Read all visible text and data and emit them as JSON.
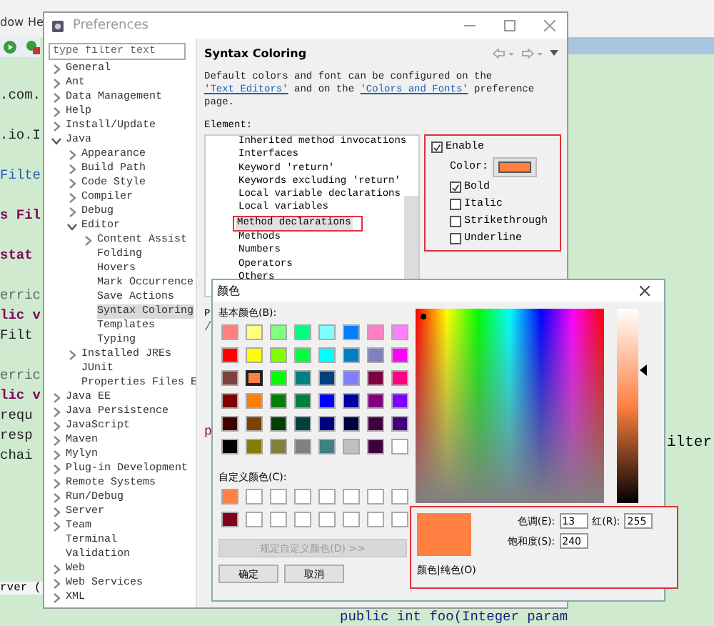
{
  "background_editor": {
    "menu": [
      "dow",
      "He"
    ],
    "left_code": [
      [
        {
          "text": ".com.",
          "kind": "plain"
        }
      ],
      [
        {
          "text": ".io.I",
          "kind": "plain"
        }
      ],
      [
        {
          "text": "Filte",
          "kind": "type"
        }
      ],
      [
        {
          "text": "s Fil",
          "kind": "keyword"
        }
      ],
      [
        {
          "text": "stat",
          "kind": "keyword"
        }
      ],
      [
        {
          "text": "erric",
          "kind": "annotation"
        },
        {
          "text": "lic v",
          "kind": "keyword"
        },
        {
          "text": "Filt",
          "kind": "plain"
        }
      ],
      [
        {
          "text": "erric",
          "kind": "annotation"
        },
        {
          "text": "lic v",
          "kind": "keyword"
        },
        {
          "text": "requ",
          "kind": "plain"
        },
        {
          "text": "resp",
          "kind": "plain"
        },
        {
          "text": "chai",
          "kind": "plain"
        }
      ]
    ],
    "bottom_left": "rver (",
    "right_code": "ilter",
    "bottom_code": "public int foo(Integer param"
  },
  "preferences": {
    "title": "Preferences",
    "filter": {
      "placeholder": "type filter text"
    },
    "tree": [
      {
        "label": "General",
        "kind": "group",
        "expanded": false,
        "selected": false
      },
      {
        "label": "Ant",
        "kind": "group",
        "expanded": false,
        "selected": false
      },
      {
        "label": "Data Management",
        "kind": "group",
        "expanded": false,
        "selected": false
      },
      {
        "label": "Help",
        "kind": "group",
        "expanded": false,
        "selected": false
      },
      {
        "label": "Install/Update",
        "kind": "group",
        "expanded": false,
        "selected": false
      },
      {
        "label": "Java",
        "kind": "group",
        "expanded": true,
        "selected": false,
        "children": [
          {
            "label": "Appearance",
            "kind": "group",
            "expanded": false,
            "selected": false
          },
          {
            "label": "Build Path",
            "kind": "group",
            "expanded": false,
            "selected": false
          },
          {
            "label": "Code Style",
            "kind": "group",
            "expanded": false,
            "selected": false
          },
          {
            "label": "Compiler",
            "kind": "group",
            "expanded": false,
            "selected": false
          },
          {
            "label": "Debug",
            "kind": "group",
            "expanded": false,
            "selected": false
          },
          {
            "label": "Editor",
            "kind": "group",
            "expanded": true,
            "selected": false,
            "children": [
              {
                "label": "Content Assist",
                "kind": "group",
                "expanded": false,
                "selected": false
              },
              {
                "label": "Folding",
                "kind": "leaf",
                "selected": false
              },
              {
                "label": "Hovers",
                "kind": "leaf",
                "selected": false
              },
              {
                "label": "Mark Occurrence",
                "kind": "leaf",
                "selected": false
              },
              {
                "label": "Save Actions",
                "kind": "leaf",
                "selected": false
              },
              {
                "label": "Syntax Coloring",
                "kind": "leaf",
                "selected": true
              },
              {
                "label": "Templates",
                "kind": "leaf",
                "selected": false
              },
              {
                "label": "Typing",
                "kind": "leaf",
                "selected": false
              }
            ]
          },
          {
            "label": "Installed JREs",
            "kind": "group",
            "expanded": false,
            "selected": false
          },
          {
            "label": "JUnit",
            "kind": "leaf",
            "selected": false
          },
          {
            "label": "Properties Files E",
            "kind": "leaf",
            "selected": false
          }
        ]
      },
      {
        "label": "Java EE",
        "kind": "group",
        "expanded": false,
        "selected": false
      },
      {
        "label": "Java Persistence",
        "kind": "group",
        "expanded": false,
        "selected": false
      },
      {
        "label": "JavaScript",
        "kind": "group",
        "expanded": false,
        "selected": false
      },
      {
        "label": "Maven",
        "kind": "group",
        "expanded": false,
        "selected": false
      },
      {
        "label": "Mylyn",
        "kind": "group",
        "expanded": false,
        "selected": false
      },
      {
        "label": "Plug-in Development",
        "kind": "group",
        "expanded": false,
        "selected": false
      },
      {
        "label": "Remote Systems",
        "kind": "group",
        "expanded": false,
        "selected": false
      },
      {
        "label": "Run/Debug",
        "kind": "group",
        "expanded": false,
        "selected": false
      },
      {
        "label": "Server",
        "kind": "group",
        "expanded": false,
        "selected": false
      },
      {
        "label": "Team",
        "kind": "group",
        "expanded": false,
        "selected": false
      },
      {
        "label": "Terminal",
        "kind": "leaf",
        "selected": false
      },
      {
        "label": "Validation",
        "kind": "leaf",
        "selected": false
      },
      {
        "label": "Web",
        "kind": "group",
        "expanded": false,
        "selected": false
      },
      {
        "label": "Web Services",
        "kind": "group",
        "expanded": false,
        "selected": false
      },
      {
        "label": "XML",
        "kind": "group",
        "expanded": false,
        "selected": false
      }
    ],
    "page_title": "Syntax Coloring",
    "description": "Default colors and font can be configured on the ",
    "link_1": "'Text Editors'",
    "description_2": " and on the ",
    "link_2": "'Colors and Fonts'",
    "description_3": " preference page.",
    "element_label": "Element:",
    "elements": [
      {
        "label": "Inherited method invocations",
        "selected": false
      },
      {
        "label": "Interfaces",
        "selected": false
      },
      {
        "label": "Keyword 'return'",
        "selected": false
      },
      {
        "label": "Keywords excluding 'return'",
        "selected": false
      },
      {
        "label": "Local variable declarations",
        "selected": false
      },
      {
        "label": "Local variables",
        "selected": false
      },
      {
        "label": "Method declarations",
        "selected": true
      },
      {
        "label": "Methods",
        "selected": false
      },
      {
        "label": "Numbers",
        "selected": false
      },
      {
        "label": "Operators",
        "selected": false
      },
      {
        "label": "Others",
        "selected": false
      }
    ],
    "options": {
      "enable": {
        "label": "Enable",
        "checked": true
      },
      "color_label": "Color:",
      "color": "#ff8040",
      "styles": [
        {
          "label": "Bold",
          "checked": true
        },
        {
          "label": "Italic",
          "checked": false
        },
        {
          "label": "Strikethrough",
          "checked": false
        },
        {
          "label": "Underline",
          "checked": false
        }
      ]
    },
    "preview_label": "P",
    "preview_code": [
      "/",
      "p"
    ]
  },
  "color_dialog": {
    "title": "颜色",
    "basic_label": "基本颜色(B):",
    "basic_colors": [
      {
        "color": "#ff8080",
        "selected": false
      },
      {
        "color": "#ffff80",
        "selected": false
      },
      {
        "color": "#80ff80",
        "selected": false
      },
      {
        "color": "#00ff80",
        "selected": false
      },
      {
        "color": "#80ffff",
        "selected": false
      },
      {
        "color": "#0080ff",
        "selected": false
      },
      {
        "color": "#ff80c0",
        "selected": false
      },
      {
        "color": "#ff80ff",
        "selected": false
      },
      {
        "color": "#ff0000",
        "selected": false
      },
      {
        "color": "#ffff00",
        "selected": false
      },
      {
        "color": "#80ff00",
        "selected": false
      },
      {
        "color": "#00ff40",
        "selected": false
      },
      {
        "color": "#00ffff",
        "selected": false
      },
      {
        "color": "#0080c0",
        "selected": false
      },
      {
        "color": "#8080c0",
        "selected": false
      },
      {
        "color": "#ff00ff",
        "selected": false
      },
      {
        "color": "#804040",
        "selected": false
      },
      {
        "color": "#ff8040",
        "selected": true
      },
      {
        "color": "#00ff00",
        "selected": false
      },
      {
        "color": "#008080",
        "selected": false
      },
      {
        "color": "#004080",
        "selected": false
      },
      {
        "color": "#8080ff",
        "selected": false
      },
      {
        "color": "#800040",
        "selected": false
      },
      {
        "color": "#ff0080",
        "selected": false
      },
      {
        "color": "#800000",
        "selected": false
      },
      {
        "color": "#ff8000",
        "selected": false
      },
      {
        "color": "#008000",
        "selected": false
      },
      {
        "color": "#008040",
        "selected": false
      },
      {
        "color": "#0000ff",
        "selected": false
      },
      {
        "color": "#0000a0",
        "selected": false
      },
      {
        "color": "#800080",
        "selected": false
      },
      {
        "color": "#8000ff",
        "selected": false
      },
      {
        "color": "#400000",
        "selected": false
      },
      {
        "color": "#804000",
        "selected": false
      },
      {
        "color": "#004000",
        "selected": false
      },
      {
        "color": "#004040",
        "selected": false
      },
      {
        "color": "#000080",
        "selected": false
      },
      {
        "color": "#000040",
        "selected": false
      },
      {
        "color": "#400040",
        "selected": false
      },
      {
        "color": "#400080",
        "selected": false
      },
      {
        "color": "#000000",
        "selected": false
      },
      {
        "color": "#808000",
        "selected": false
      },
      {
        "color": "#808040",
        "selected": false
      },
      {
        "color": "#808080",
        "selected": false
      },
      {
        "color": "#408080",
        "selected": false
      },
      {
        "color": "#c0c0c0",
        "selected": false
      },
      {
        "color": "#400040",
        "selected": false
      },
      {
        "color": "#ffffff",
        "selected": false
      }
    ],
    "custom_label": "自定义颜色(C):",
    "custom_colors": [
      {
        "color": "#ff8040"
      },
      {
        "color": "#ffffff"
      },
      {
        "color": "#ffffff"
      },
      {
        "color": "#ffffff"
      },
      {
        "color": "#ffffff"
      },
      {
        "color": "#ffffff"
      },
      {
        "color": "#ffffff"
      },
      {
        "color": "#ffffff"
      },
      {
        "color": "#800020"
      },
      {
        "color": "#ffffff"
      },
      {
        "color": "#ffffff"
      },
      {
        "color": "#ffffff"
      },
      {
        "color": "#ffffff"
      },
      {
        "color": "#ffffff"
      },
      {
        "color": "#ffffff"
      },
      {
        "color": "#ffffff"
      }
    ],
    "define_button": {
      "label": "规定自定义颜色(D) >>",
      "disabled": true
    },
    "ok_button": "确定",
    "cancel_button": "取消",
    "preview_swatch": {
      "color": "#ff8040"
    },
    "preview_label": "颜色|纯色(O)",
    "fields": [
      {
        "label": "色调(E):",
        "value": "13"
      },
      {
        "label": "红(R):",
        "value": "255"
      },
      {
        "label": "饱和度(S):",
        "value": "240"
      }
    ]
  }
}
